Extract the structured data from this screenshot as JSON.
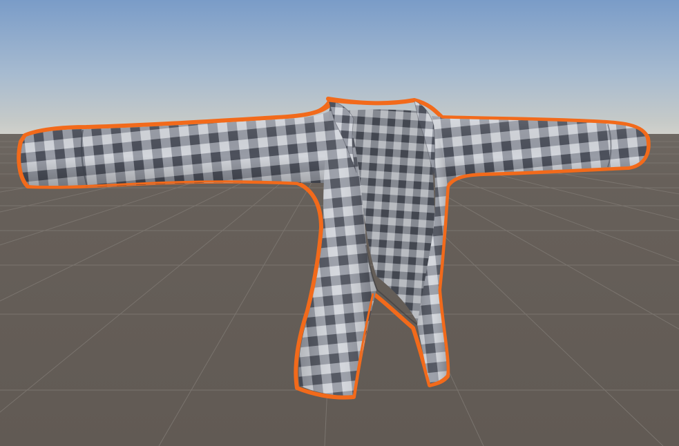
{
  "scene": {
    "colors": {
      "sky_top": "#7c9ec9",
      "sky_mid": "#a9bccf",
      "horizon": "#c9ccc8",
      "ground": "#645d57",
      "ground_far": "#6a645e",
      "grid_line": "#7b756f",
      "selection_outline": "#f26a1b",
      "check_dark": "#505460",
      "check_mid": "#8c909a",
      "check_light": "#d6d8de"
    },
    "grid": "on",
    "selected_object": "shirt-mesh"
  }
}
